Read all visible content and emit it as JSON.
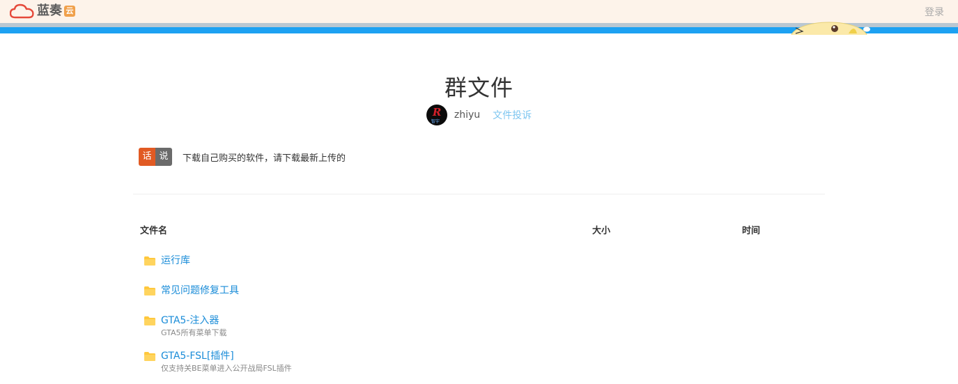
{
  "header": {
    "logo_text": "蓝奏",
    "logo_badge": "云",
    "login_label": "登录"
  },
  "page": {
    "title": "群文件",
    "owner_name": "zhiyu",
    "report_label": "文件投诉",
    "avatar_letter": "R",
    "avatar_caption": "智宇"
  },
  "notice": {
    "tag_a": "话",
    "tag_b": "说",
    "text": "下载自己购买的软件，请下载最新上传的"
  },
  "table": {
    "columns": [
      "文件名",
      "大小",
      "时间"
    ]
  },
  "files": [
    {
      "name": "运行库",
      "desc": ""
    },
    {
      "name": "常见问题修复工具",
      "desc": ""
    },
    {
      "name": "GTA5-注入器",
      "desc": "GTA5所有菜单下载"
    },
    {
      "name": "GTA5-FSL[插件]",
      "desc": "仅支持关BE菜单进入公开战局FSL插件"
    }
  ],
  "colors": {
    "topbar_bg": "#fdf3ea",
    "accent_blue": "#1da1f2",
    "link_blue": "#1a8cd8",
    "folder_yellow": "#ffc83d",
    "tag_orange": "#e15a23",
    "tag_grey": "#6b6b6b"
  }
}
